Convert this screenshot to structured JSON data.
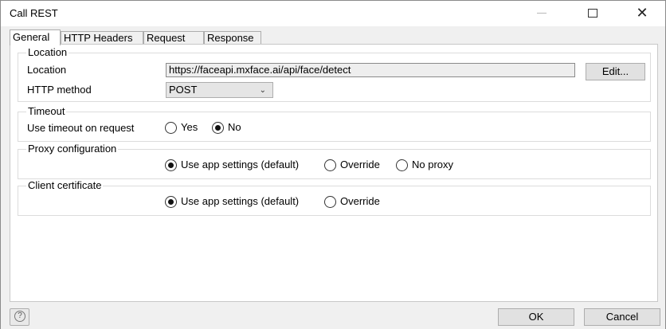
{
  "window": {
    "title": "Call REST"
  },
  "tabs": [
    {
      "label": "General",
      "active": true
    },
    {
      "label": "HTTP Headers",
      "active": false
    },
    {
      "label": "Request",
      "active": false
    },
    {
      "label": "Response",
      "active": false
    }
  ],
  "location_group": {
    "title": "Location",
    "location_label": "Location",
    "location_value": "https://faceapi.mxface.ai/api/face/detect",
    "edit_button": "Edit...",
    "http_method_label": "HTTP method",
    "http_method_value": "POST"
  },
  "timeout_group": {
    "title": "Timeout",
    "use_timeout_label": "Use timeout on request",
    "options": [
      {
        "label": "Yes",
        "selected": false
      },
      {
        "label": "No",
        "selected": true
      }
    ]
  },
  "proxy_group": {
    "title": "Proxy configuration",
    "options": [
      {
        "label": "Use app settings (default)",
        "selected": true
      },
      {
        "label": "Override",
        "selected": false
      },
      {
        "label": "No proxy",
        "selected": false
      }
    ]
  },
  "cert_group": {
    "title": "Client certificate",
    "options": [
      {
        "label": "Use app settings (default)",
        "selected": true
      },
      {
        "label": "Override",
        "selected": false
      }
    ]
  },
  "footer": {
    "help_icon": "?",
    "ok_label": "OK",
    "cancel_label": "Cancel"
  },
  "icons": {
    "minimize": "minimize-icon",
    "maximize": "maximize-icon",
    "close": "close-icon",
    "chevron": "chevron-down-icon",
    "help": "help-icon"
  }
}
